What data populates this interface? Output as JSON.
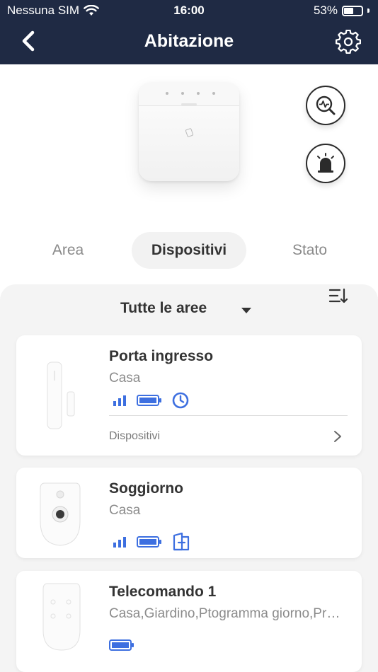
{
  "status_bar": {
    "carrier": "Nessuna SIM",
    "time": "16:00",
    "battery": "53%",
    "battery_level": 0.53
  },
  "header": {
    "title": "Abitazione",
    "back_icon": "chevron-left-icon",
    "settings_icon": "gear-icon"
  },
  "hub_actions": [
    {
      "icon": "diagnostics-search-icon"
    },
    {
      "icon": "siren-icon"
    }
  ],
  "tabs": [
    {
      "label": "Area"
    },
    {
      "label": "Dispositivi",
      "active": true
    },
    {
      "label": "Stato"
    }
  ],
  "filter": {
    "label": "Tutte le aree",
    "sort_icon": "sort-icon"
  },
  "devices": [
    {
      "name": "Porta ingresso",
      "area": "Casa",
      "status_icons": [
        "signal-icon",
        "battery-icon",
        "clock-icon"
      ],
      "link_label": "Dispositivi"
    },
    {
      "name": "Soggiorno",
      "area": "Casa",
      "status_icons": [
        "signal-icon",
        "battery-icon",
        "zone-door-icon"
      ]
    },
    {
      "name": "Telecomando 1",
      "area": "Casa,Giardino,Ptogramma giorno,Programma notte",
      "status_icons": [
        "battery-icon"
      ]
    }
  ],
  "colors": {
    "header_bg": "#1f2a44",
    "accent_blue": "#3d6fe0",
    "panel_bg": "#f4f4f4"
  }
}
